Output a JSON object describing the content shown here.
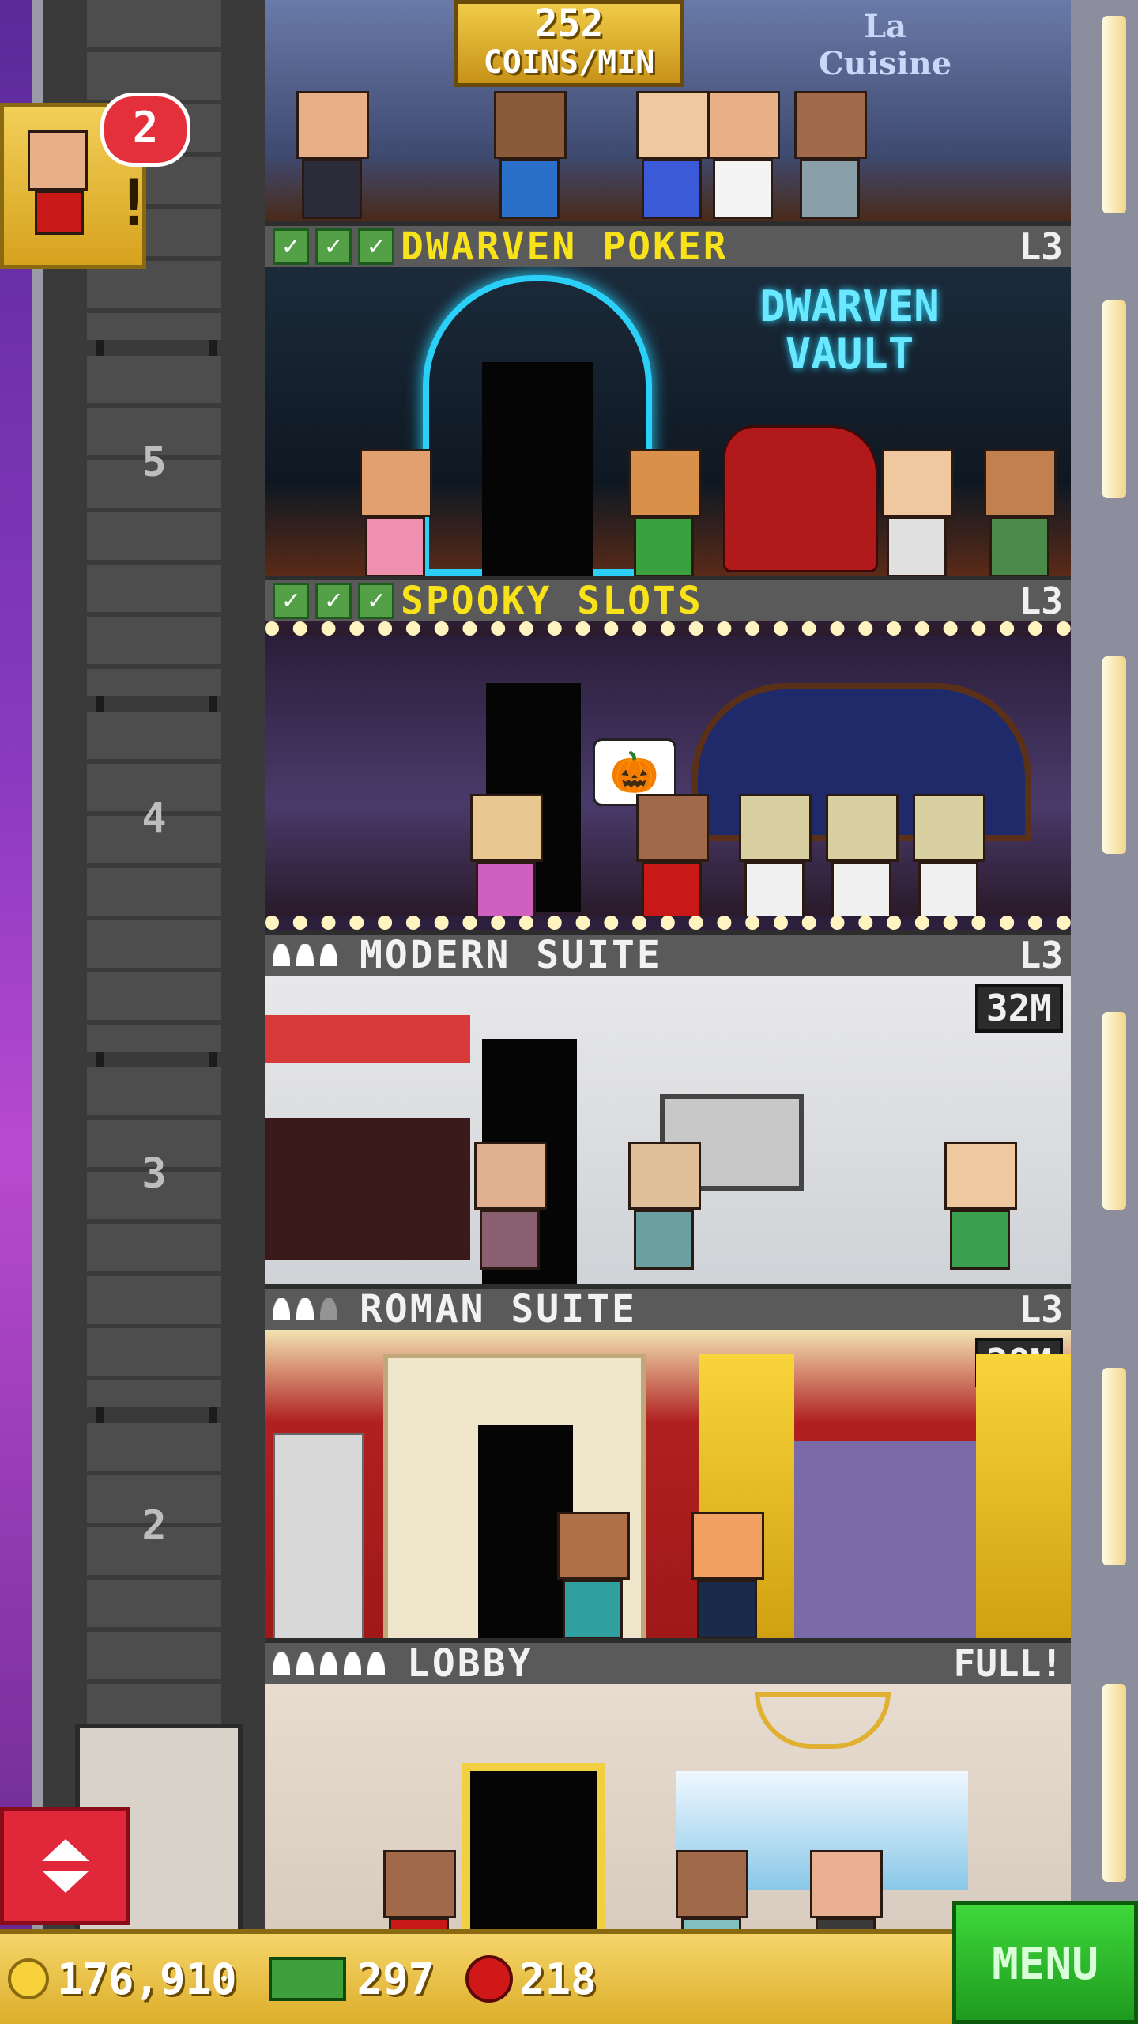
{
  "top_room": {
    "coins_value": "252",
    "coins_label": "COINS/MIN",
    "sign_text": "La Cuisine"
  },
  "notification": {
    "count": "2"
  },
  "elevator": {
    "floor_numbers": [
      "5",
      "4",
      "3",
      "2"
    ]
  },
  "floors": [
    {
      "name": "DWARVEN POKER",
      "level": "L3",
      "sign": "DWARVEN VAULT"
    },
    {
      "name": "SPOOKY SLOTS",
      "level": "L3"
    },
    {
      "name": "MODERN SUITE",
      "level": "L3",
      "price": "32M"
    },
    {
      "name": "ROMAN SUITE",
      "level": "L3",
      "price": "38M"
    },
    {
      "name": "LOBBY",
      "level": "FULL!"
    }
  ],
  "status": {
    "coins": "176,910",
    "cash": "297",
    "bux": "218"
  },
  "menu_label": "MENU",
  "colors": {
    "gold": "#f0cb48",
    "menu_green": "#3ed83a",
    "title_yellow": "#f8e21a"
  }
}
